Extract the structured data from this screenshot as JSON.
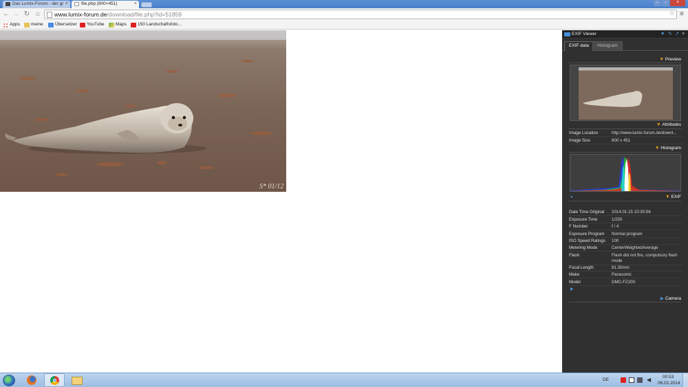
{
  "browser": {
    "tabs": [
      {
        "title": "Das Lumix-Forum - der gr",
        "active": false
      },
      {
        "title": "file.php (800×451)",
        "active": true
      }
    ],
    "url_host": "www.lumix-forum.de",
    "url_path": "/download/file.php?id=51859"
  },
  "bookmarks": [
    {
      "label": "Apps",
      "icon": "apps-icon"
    },
    {
      "label": "meine",
      "icon": "folder-icon"
    },
    {
      "label": "Übersetzer",
      "icon": "translate-icon"
    },
    {
      "label": "YouTube",
      "icon": "youtube-icon"
    },
    {
      "label": "Maps",
      "icon": "maps-icon"
    },
    {
      "label": "150 Landschaftsfoto...",
      "icon": "youtube-icon"
    }
  ],
  "photo": {
    "watermark": "S* 01/12",
    "subject": "seal on beach"
  },
  "exif_viewer": {
    "title": "EXIF Viewer",
    "tabs": {
      "active": "EXIF data",
      "inactive": "Histogram"
    },
    "sections": {
      "preview": "Preview",
      "attributes": "Attributes",
      "histogram": "Histogram",
      "exif": "EXIF",
      "camera": "Camera"
    },
    "attributes": [
      {
        "key": "Image Location",
        "value": "http://www.lumix-forum.de/downl..."
      },
      {
        "key": "Image Size",
        "value": "800 x 451"
      }
    ],
    "exif": [
      {
        "key": "Date Time Original",
        "value": "2014:01:15 10:30:56"
      },
      {
        "key": "Exposure Time",
        "value": "1/250"
      },
      {
        "key": "F Number",
        "value": "f / 4"
      },
      {
        "key": "Exposure Program",
        "value": "Normal program"
      },
      {
        "key": "ISO Speed Ratings",
        "value": "100"
      },
      {
        "key": "Metering Mode",
        "value": "CenterWeightedAverage"
      },
      {
        "key": "Flash",
        "value": "Flash did not fire, compulsory flash mode"
      },
      {
        "key": "Focal Length",
        "value": "81.30mm"
      },
      {
        "key": "Make",
        "value": "Panasonic"
      },
      {
        "key": "Model",
        "value": "DMC-FZ200"
      }
    ]
  },
  "taskbar": {
    "language": "DE",
    "time": "00:53",
    "date": "06.02.2014",
    "apps": [
      {
        "name": "firefox",
        "icon": "firefox-icon"
      },
      {
        "name": "chrome",
        "icon": "chrome-icon",
        "active": true
      },
      {
        "name": "explorer",
        "icon": "explorer-icon"
      }
    ]
  },
  "colors": {
    "titlebar": "#4a7fc9",
    "panel_bg": "#303030",
    "accent_orange": "#f0a81e",
    "taskbar": "#a9c5e6"
  }
}
